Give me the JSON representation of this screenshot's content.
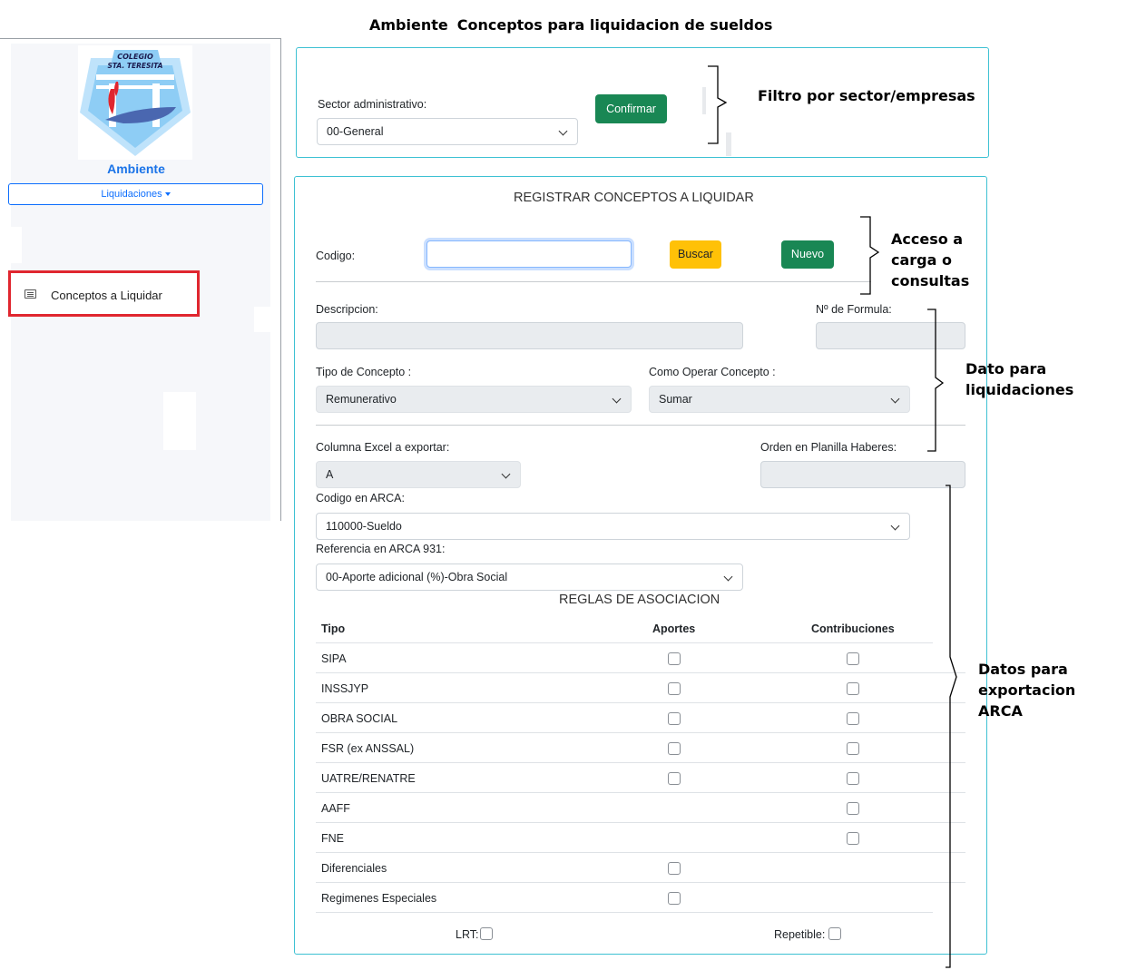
{
  "header": {
    "left_title": "Ambiente",
    "right_title": "Conceptos para liquidacion de sueldos"
  },
  "sidebar": {
    "logo": {
      "line1": "COLEGIO",
      "line2": "STA. TERESITA",
      "shield_color": "#8ecdf5",
      "accent_red": "#e0262f"
    },
    "brand": "Ambiente",
    "menu_button": "Liquidaciones",
    "items": [
      {
        "label": "Conceptos a Liquidar",
        "icon": "list-icon"
      }
    ],
    "highlight_color": "#e0262f"
  },
  "filter": {
    "label": "Sector administrativo:",
    "selected": "00-General",
    "confirm_label": "Confirmar"
  },
  "form": {
    "title": "REGISTRAR CONCEPTOS A LIQUIDAR",
    "codigo_label": "Codigo:",
    "codigo_value": "",
    "search_label": "Buscar",
    "new_label": "Nuevo",
    "descripcion_label": "Descripcion:",
    "formula_label": "Nº de Formula:",
    "tipo_label": "Tipo de Concepto :",
    "tipo_value": "Remunerativo",
    "operar_label": "Como Operar Concepto :",
    "operar_value": "Sumar",
    "excel_label": "Columna Excel a exportar:",
    "excel_value": "A",
    "orden_label": "Orden en Planilla Haberes:",
    "arca_label": "Codigo en ARCA:",
    "arca_value": "110000-Sueldo",
    "ref931_label": "Referencia en ARCA 931:",
    "ref931_value": "00-Aporte adicional (%)-Obra Social"
  },
  "rules": {
    "title": "REGLAS DE ASOCIACION",
    "headers": {
      "tipo": "Tipo",
      "aportes": "Aportes",
      "contribuciones": "Contribuciones"
    },
    "rows": [
      {
        "tipo": "SIPA",
        "aportes": false,
        "contribuciones": false
      },
      {
        "tipo": "INSSJYP",
        "aportes": false,
        "contribuciones": false
      },
      {
        "tipo": "OBRA SOCIAL",
        "aportes": false,
        "contribuciones": false
      },
      {
        "tipo": "FSR (ex ANSSAL)",
        "aportes": false,
        "contribuciones": false
      },
      {
        "tipo": "UATRE/RENATRE",
        "aportes": false,
        "contribuciones": false
      },
      {
        "tipo": "AAFF",
        "aportes": null,
        "contribuciones": false
      },
      {
        "tipo": "FNE",
        "aportes": null,
        "contribuciones": false
      },
      {
        "tipo": "Diferenciales",
        "aportes": false,
        "contribuciones": null
      },
      {
        "tipo": "Regimenes Especiales",
        "aportes": false,
        "contribuciones": null
      }
    ],
    "lrt_label": "LRT:",
    "repetible_label": "Repetible:"
  },
  "annotations": {
    "filter": "Filtro por sector/empresas",
    "access": [
      "Acceso a",
      "carga o",
      "consultas"
    ],
    "liquid": [
      "Dato para",
      "liquidaciones"
    ],
    "arca": [
      "Datos para",
      "exportacion",
      "ARCA"
    ]
  },
  "colors": {
    "panel_border": "#3ec1d3",
    "green": "#198754",
    "yellow": "#ffc107",
    "link_blue": "#0d6efd"
  }
}
